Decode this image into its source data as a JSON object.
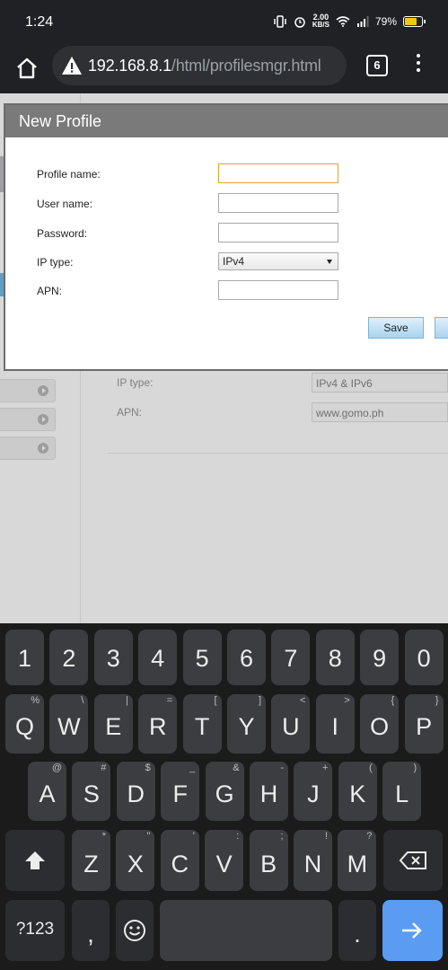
{
  "status_bar": {
    "time": "1:24",
    "net_speed_value": "2.00",
    "net_speed_unit": "KB/S",
    "battery": "79%"
  },
  "browser": {
    "url_host": "192.168.8.1",
    "url_path": "/html/profilesmgr.html",
    "tab_count": "6"
  },
  "background_page": {
    "ip_type_label": "IP type:",
    "ip_type_value": "IPv4 & IPv6",
    "apn_label": "APN:",
    "apn_value": "www.gomo.ph"
  },
  "dialog": {
    "title": "New Profile",
    "fields": {
      "profile_name_label": "Profile name:",
      "profile_name_value": "",
      "user_name_label": "User name:",
      "user_name_value": "",
      "password_label": "Password:",
      "password_value": "",
      "ip_type_label": "IP type:",
      "ip_type_selected": "IPv4",
      "apn_label": "APN:",
      "apn_value": ""
    },
    "save_label": "Save"
  },
  "keyboard": {
    "number_row": [
      "1",
      "2",
      "3",
      "4",
      "5",
      "6",
      "7",
      "8",
      "9",
      "0"
    ],
    "row1": [
      {
        "k": "Q",
        "s": "%"
      },
      {
        "k": "W",
        "s": "\\"
      },
      {
        "k": "E",
        "s": "|"
      },
      {
        "k": "R",
        "s": "="
      },
      {
        "k": "T",
        "s": "["
      },
      {
        "k": "Y",
        "s": "]"
      },
      {
        "k": "U",
        "s": "<"
      },
      {
        "k": "I",
        "s": ">"
      },
      {
        "k": "O",
        "s": "{"
      },
      {
        "k": "P",
        "s": "}"
      }
    ],
    "row2": [
      {
        "k": "A",
        "s": "@"
      },
      {
        "k": "S",
        "s": "#"
      },
      {
        "k": "D",
        "s": "$"
      },
      {
        "k": "F",
        "s": "_"
      },
      {
        "k": "G",
        "s": "&"
      },
      {
        "k": "H",
        "s": "-"
      },
      {
        "k": "J",
        "s": "+"
      },
      {
        "k": "K",
        "s": "("
      },
      {
        "k": "L",
        "s": ")"
      }
    ],
    "row3": [
      {
        "k": "Z",
        "s": "*"
      },
      {
        "k": "X",
        "s": "\""
      },
      {
        "k": "C",
        "s": "'"
      },
      {
        "k": "V",
        "s": ":"
      },
      {
        "k": "B",
        "s": ";"
      },
      {
        "k": "N",
        "s": "!"
      },
      {
        "k": "M",
        "s": "?"
      }
    ],
    "symbols_label": "?123",
    "comma": ",",
    "period": ".",
    "emoji_icon": "smiley-icon",
    "enter_icon": "arrow-right-icon"
  }
}
